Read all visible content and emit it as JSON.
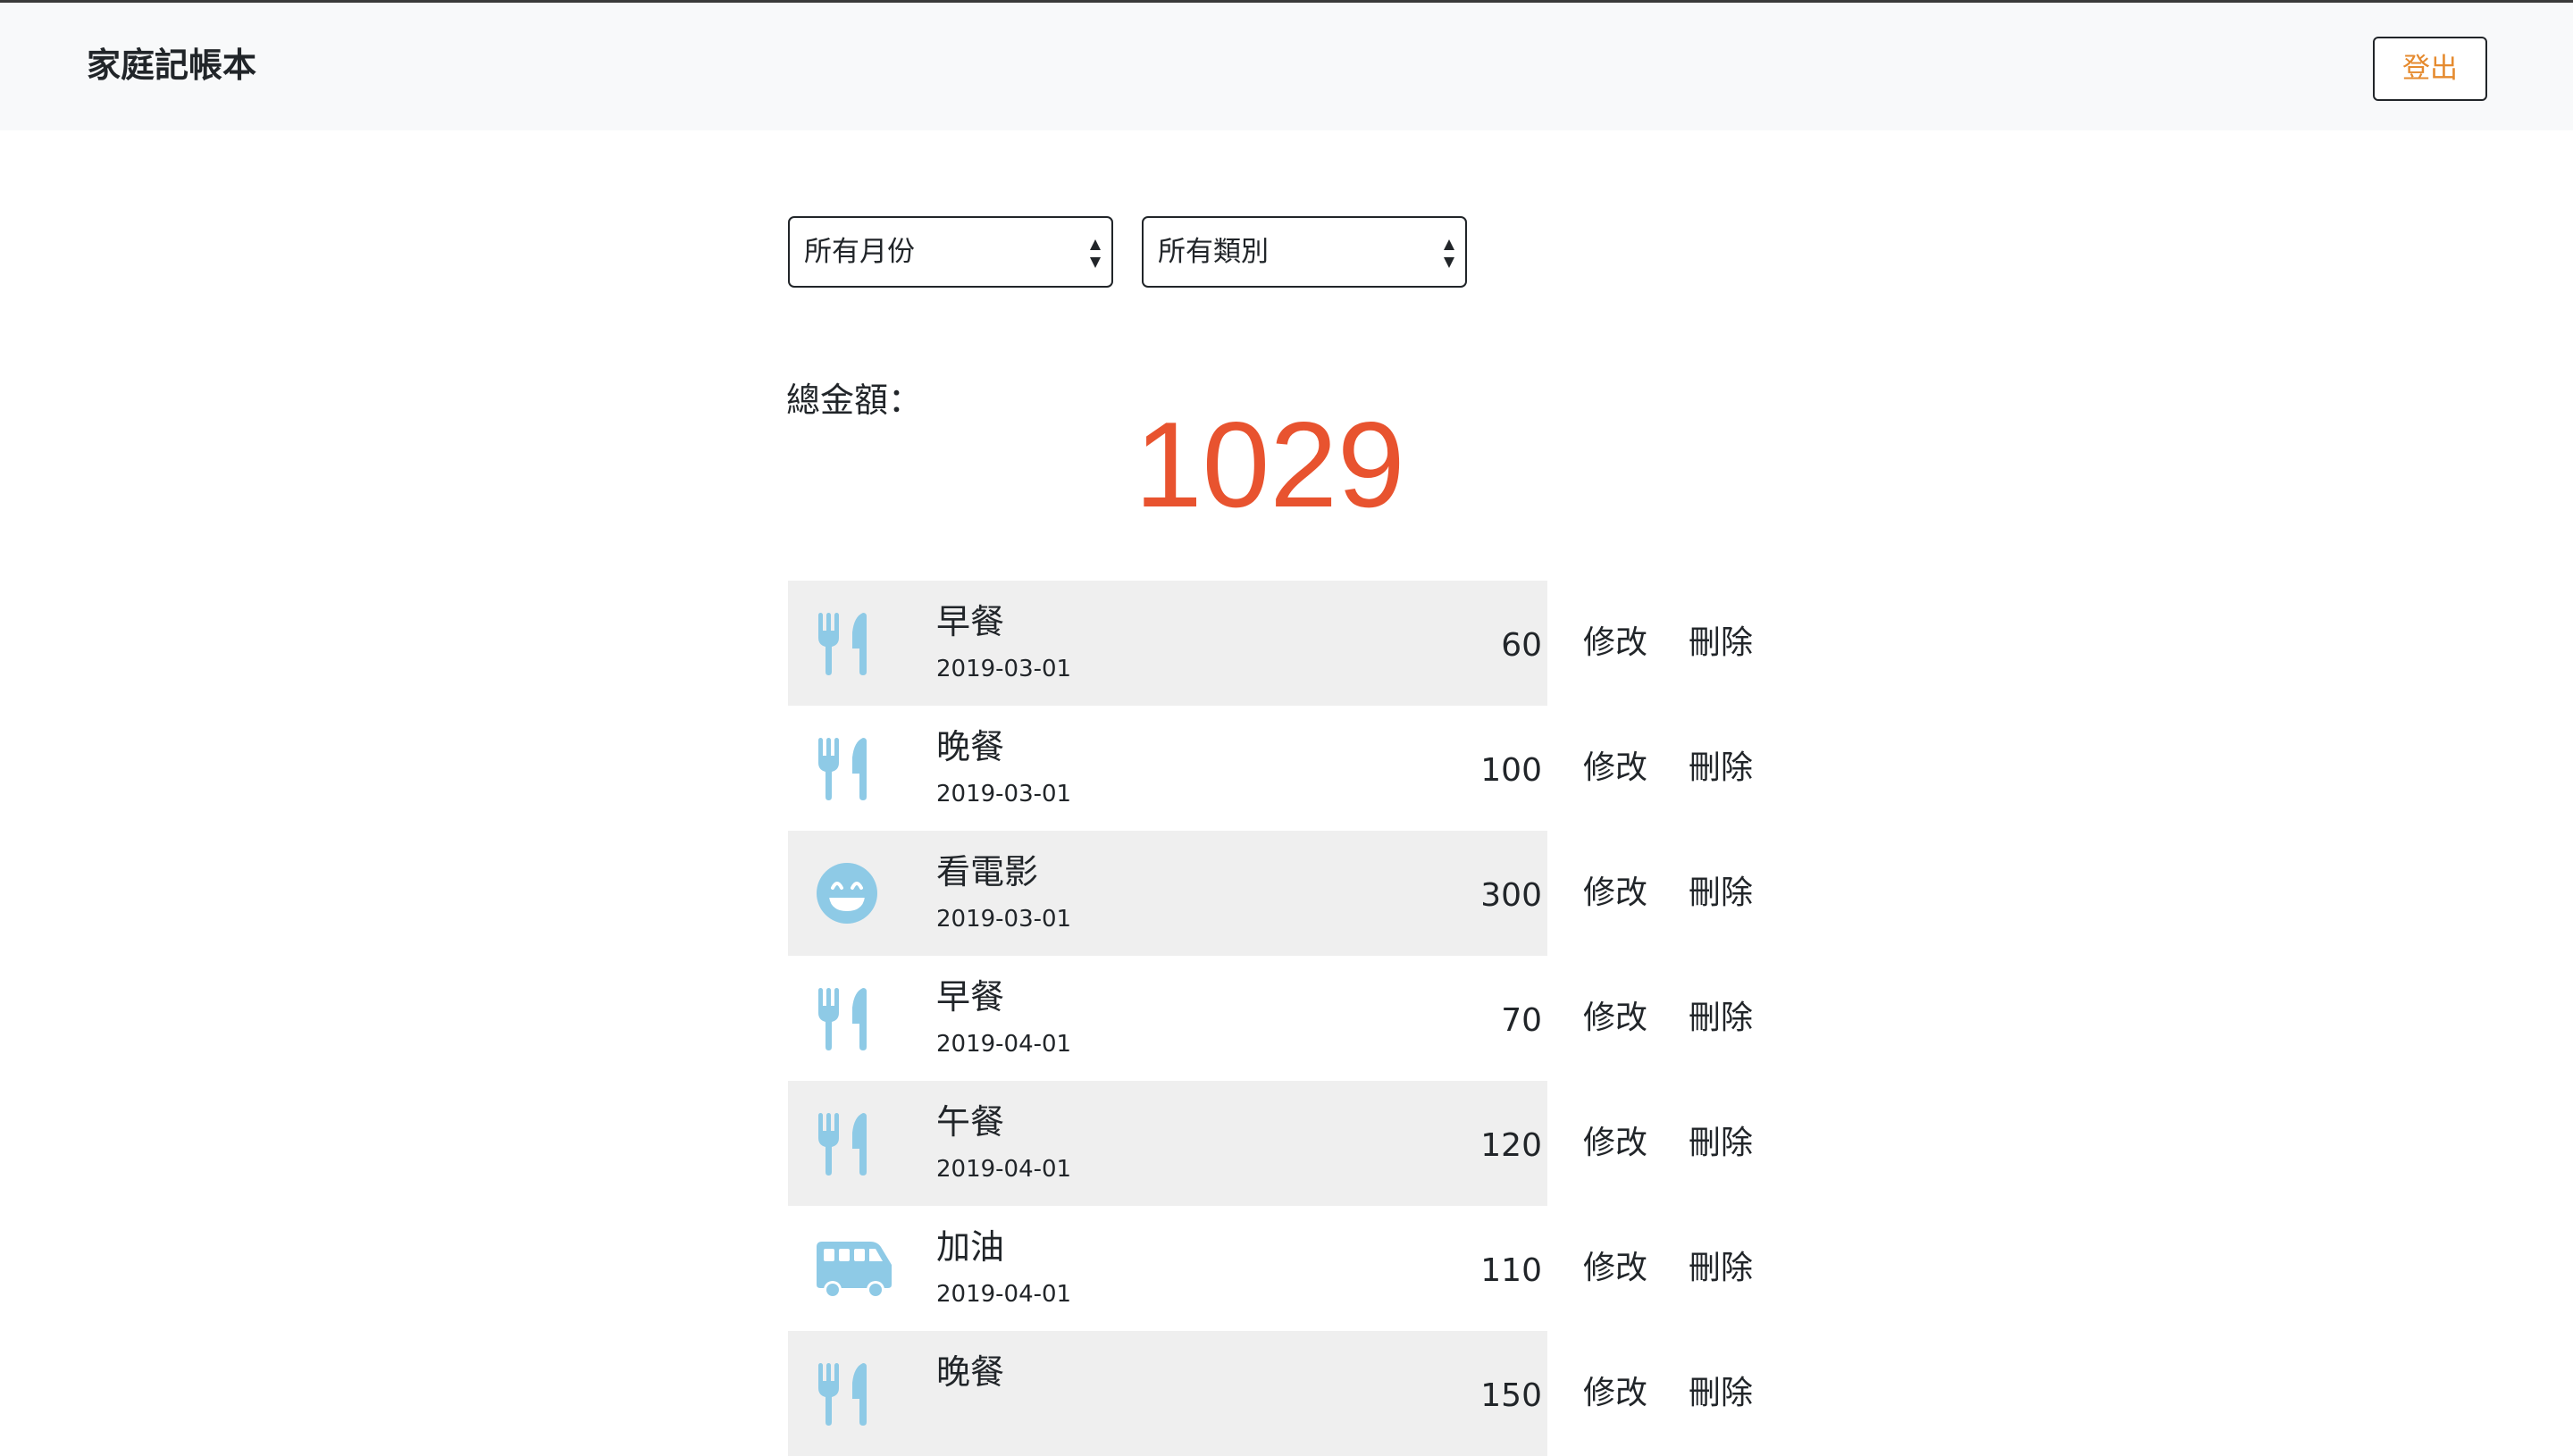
{
  "navbar": {
    "brand": "家庭記帳本",
    "logout_label": "登出"
  },
  "filters": {
    "month": {
      "selected": "所有月份"
    },
    "category": {
      "selected": "所有類別"
    }
  },
  "summary": {
    "total_label": "總金額：",
    "total_value": "1029"
  },
  "colors": {
    "icon": "#8ecae6",
    "total": "#e8532f",
    "logout_text": "#e58a2e",
    "row_shade": "#efefef"
  },
  "records": [
    {
      "icon": "utensils-icon",
      "name": "早餐",
      "date": "2019-03-01",
      "amount": "60",
      "edit": "修改",
      "delete": "刪除"
    },
    {
      "icon": "utensils-icon",
      "name": "晚餐",
      "date": "2019-03-01",
      "amount": "100",
      "edit": "修改",
      "delete": "刪除"
    },
    {
      "icon": "smile-icon",
      "name": "看電影",
      "date": "2019-03-01",
      "amount": "300",
      "edit": "修改",
      "delete": "刪除"
    },
    {
      "icon": "utensils-icon",
      "name": "早餐",
      "date": "2019-04-01",
      "amount": "70",
      "edit": "修改",
      "delete": "刪除"
    },
    {
      "icon": "utensils-icon",
      "name": "午餐",
      "date": "2019-04-01",
      "amount": "120",
      "edit": "修改",
      "delete": "刪除"
    },
    {
      "icon": "van-icon",
      "name": "加油",
      "date": "2019-04-01",
      "amount": "110",
      "edit": "修改",
      "delete": "刪除"
    },
    {
      "icon": "utensils-icon",
      "name": "晚餐",
      "date": "",
      "amount": "150",
      "edit": "修改",
      "delete": "刪除"
    }
  ]
}
